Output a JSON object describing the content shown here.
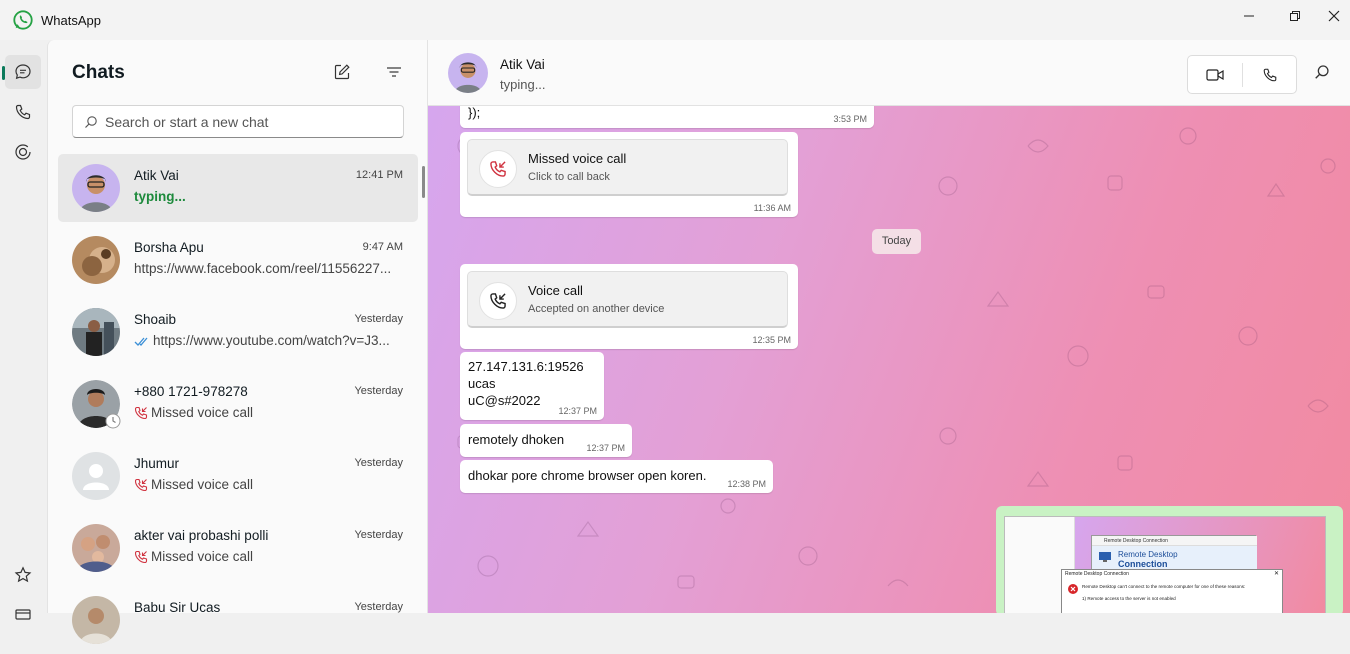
{
  "app": {
    "title": "WhatsApp"
  },
  "colors": {
    "accent": "#0b7a5b",
    "typing": "#1d8a3c",
    "missed": "#d03340"
  },
  "chat_list": {
    "title": "Chats",
    "search_placeholder": "Search or start a new chat",
    "chats": [
      {
        "name": "Atik Vai",
        "time": "12:41 PM",
        "preview": "typing...",
        "kind": "typing"
      },
      {
        "name": "Borsha Apu",
        "time": "9:47 AM",
        "preview": "https://www.facebook.com/reel/11556227...",
        "kind": "text"
      },
      {
        "name": "Shoaib",
        "time": "Yesterday",
        "preview": "https://www.youtube.com/watch?v=J3...",
        "kind": "read"
      },
      {
        "name": "+880 1721-978278",
        "time": "Yesterday",
        "preview": "Missed voice call",
        "kind": "missed"
      },
      {
        "name": "Jhumur",
        "time": "Yesterday",
        "preview": "Missed voice call",
        "kind": "missed"
      },
      {
        "name": "akter vai probashi polli",
        "time": "Yesterday",
        "preview": "Missed voice call",
        "kind": "missed"
      },
      {
        "name": "Babu Sir Ucas",
        "time": "Yesterday",
        "preview": "",
        "kind": "text"
      }
    ]
  },
  "conversation": {
    "contact_name": "Atik Vai",
    "status": "typing...",
    "date_chip": "Today",
    "messages": {
      "code_tail": {
        "text": "});",
        "time": "3:53 PM"
      },
      "missed_call": {
        "title": "Missed voice call",
        "subtitle": "Click to call back",
        "time": "11:36 AM"
      },
      "voice_call": {
        "title": "Voice call",
        "subtitle": "Accepted on another device",
        "time": "12:35 PM"
      },
      "credentials": {
        "text": "27.147.131.6:19526\nucas\nuC@s#2022",
        "time": "12:37 PM"
      },
      "remotely": {
        "text": "remotely dhoken",
        "time": "12:37 PM"
      },
      "chrome": {
        "text": "dhokar pore chrome browser open koren.",
        "time": "12:38 PM"
      }
    },
    "image_preview": {
      "window_title": "Remote Desktop Connection",
      "product_line1": "Remote Desktop",
      "product_line2": "Connection",
      "dialog_title": "Remote Desktop Connection",
      "error_text": "Remote Desktop can't connect to the remote computer for one of these reasons:",
      "reason_1": "1) Remote access to the server is not enabled"
    }
  }
}
